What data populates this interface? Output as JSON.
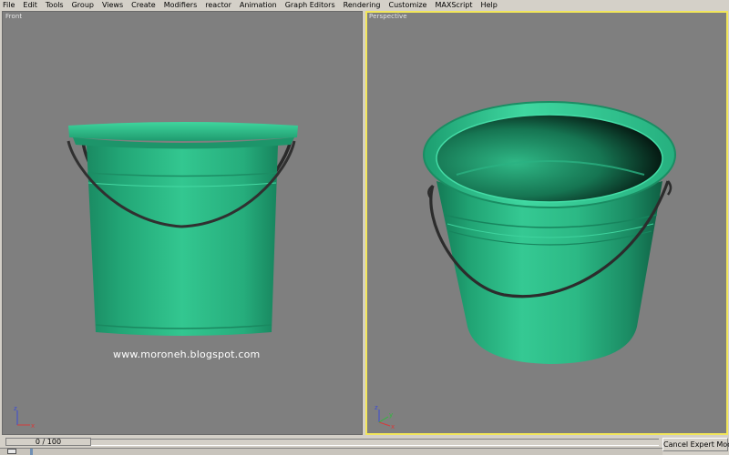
{
  "menu": [
    "File",
    "Edit",
    "Tools",
    "Group",
    "Views",
    "Create",
    "Modifiers",
    "reactor",
    "Animation",
    "Graph Editors",
    "Rendering",
    "Customize",
    "MAXScript",
    "Help"
  ],
  "viewports": {
    "front": {
      "label": "Front"
    },
    "perspective": {
      "label": "Perspective"
    }
  },
  "watermark": "www.moroneh.blogspot.com",
  "axis": {
    "x": "x",
    "y": "y",
    "z": "z"
  },
  "colors": {
    "viewport_bg": "#7f7f7f",
    "active_border": "#f2e65a",
    "bucket_green": "#2fbd8a",
    "handle": "#333333"
  },
  "time_slider": {
    "value": "0 / 100"
  },
  "buttons": {
    "cancel_expert": "Cancel Expert Mode"
  }
}
